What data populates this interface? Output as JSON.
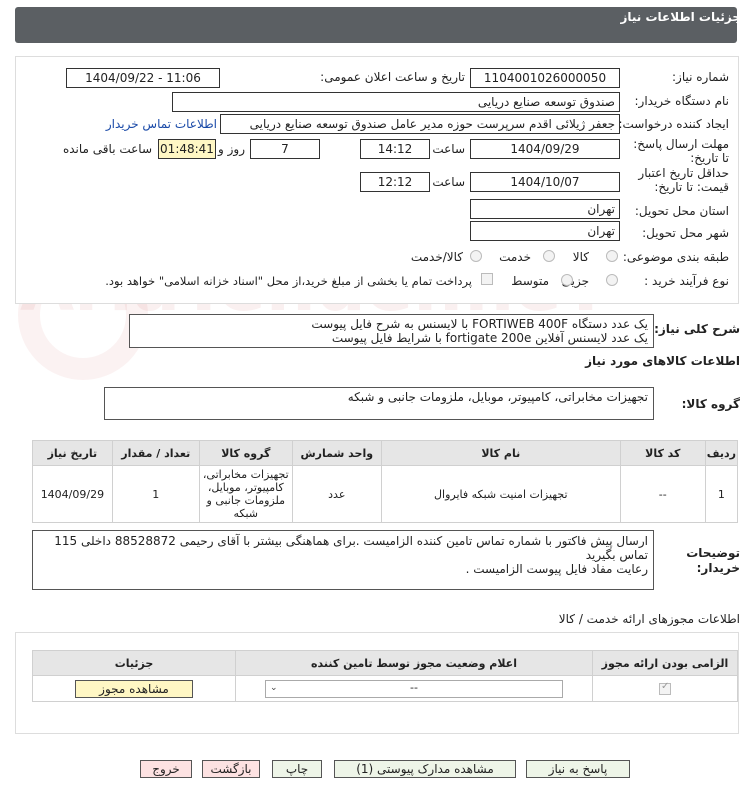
{
  "header": {
    "title": "جزئیات اطلاعات نیاز"
  },
  "form": {
    "need_number_label": "شماره نیاز:",
    "need_number": "1104001026000050",
    "announce_label": "تاریخ و ساعت اعلان عمومی:",
    "announce_value": "1404/09/22 - 11:06",
    "buyer_label": "نام دستگاه خریدار:",
    "buyer_value": "صندوق توسعه صنایع دریایی",
    "creator_label": "ایجاد کننده درخواست:",
    "creator_value": "جعفر ژیلائی اقدم سرپرست حوزه مدیر عامل صندوق توسعه صنایع دریایی",
    "contact_link": "اطلاعات تماس خریدار",
    "deadline_label": "مهلت ارسال پاسخ: تا تاریخ:",
    "deadline_date": "1404/09/29",
    "hour_label": "ساعت",
    "deadline_time": "14:12",
    "days_value": "7",
    "days_label": "روز و",
    "remaining_time": "01:48:41",
    "remaining_label": "ساعت باقی مانده",
    "validity_label": "حداقل تاریخ اعتبار قیمت: تا تاریخ:",
    "validity_date": "1404/10/07",
    "validity_time": "12:12",
    "province_label": "استان محل تحویل:",
    "province_value": "تهران",
    "city_label": "شهر محل تحویل:",
    "city_value": "تهران",
    "category_label": "طبقه بندی موضوعی:",
    "category_options": [
      "کالا",
      "خدمت",
      "کالا/خدمت"
    ],
    "process_label": "نوع فرآیند خرید :",
    "process_options": [
      "جزیی",
      "متوسط"
    ],
    "payment_note": "پرداخت تمام یا بخشی از مبلغ خرید،از محل \"اسناد خزانه اسلامی\" خواهد بود."
  },
  "summary": {
    "label": "شرح کلی نیاز:",
    "line1": "یک عدد دستگاه FORTIWEB 400F با لایسنس به شرح فایل پیوست",
    "line2": "یک عدد لایسنس آفلاین fortigate 200e با شرایط فایل پیوست"
  },
  "goods": {
    "section_title": "اطلاعات کالاهای مورد نیاز",
    "group_label": "گروه کالا:",
    "group_value": "تجهیزات مخابراتی، کامپیوتر، موبایل، ملزومات جانبی و شبکه",
    "columns": [
      "ردیف",
      "کد کالا",
      "نام کالا",
      "واحد شمارش",
      "گروه کالا",
      "تعداد / مقدار",
      "تاریخ نیاز"
    ],
    "rows": [
      {
        "row": "1",
        "code": "--",
        "name": "تجهیزات امنیت شبکه فایروال",
        "unit": "عدد",
        "group": "تجهیزات مخابراتی، کامپیوتر، موبایل، ملزومات جانبی و شبکه",
        "qty": "1",
        "date": "1404/09/29"
      }
    ]
  },
  "buyer_notes": {
    "label": "توضیحات خریدار:",
    "line1": "ارسال پیش فاکتور با شماره تماس تامین کننده الزامیست .برای هماهنگی بیشتر با آقای رحیمی 88528872 داخلی 115",
    "line2": "تماس بگیرید",
    "line3": "رعایت مفاد فایل پیوست الزامیست ."
  },
  "permits": {
    "title": "اطلاعات مجوزهای ارائه خدمت / کالا",
    "col_required": "الزامی بودن ارائه مجوز",
    "col_status": "اعلام وضعیت مجوز توسط تامین کننده",
    "col_details": "جزئیات",
    "select_value": "--",
    "view_button": "مشاهده مجوز"
  },
  "footer": {
    "reply": "پاسخ به نیاز",
    "docs": "مشاهده مدارک پیوستی (1)",
    "print": "چاپ",
    "back": "بازگشت",
    "exit": "خروج"
  },
  "watermark": "AriaTender.neT"
}
